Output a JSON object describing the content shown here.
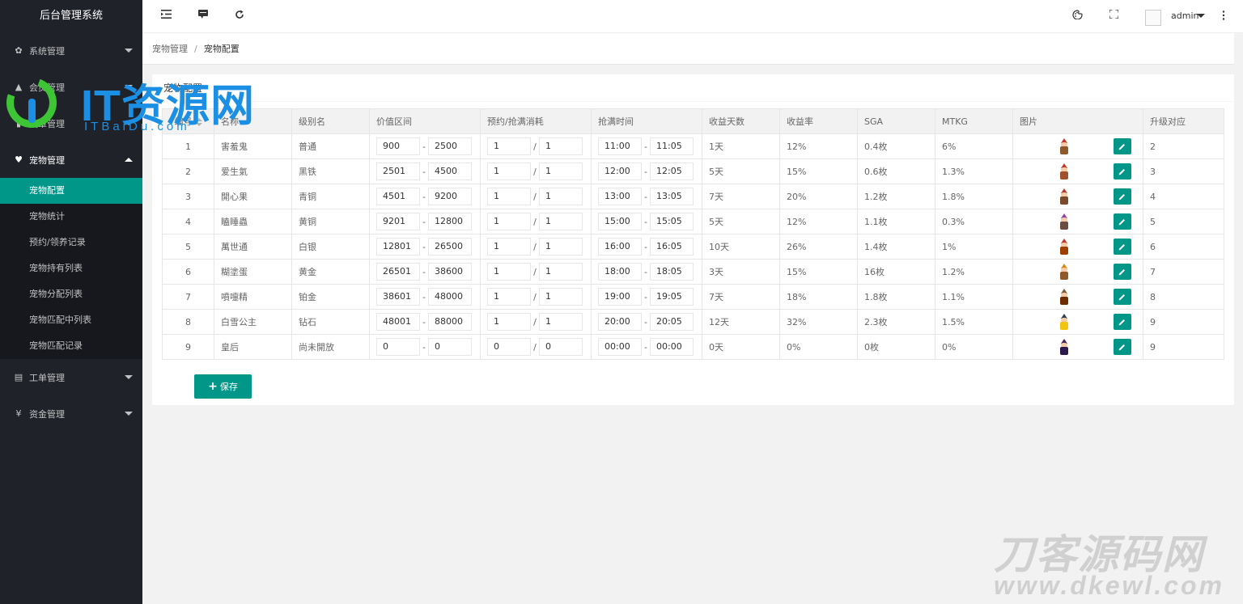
{
  "app_title": "后台管理系统",
  "sidebar": {
    "groups": [
      {
        "label": "系统管理",
        "icon": "gear-icon",
        "glyph": "✿",
        "open": false
      },
      {
        "label": "会员管理",
        "icon": "user-icon",
        "glyph": "▲",
        "open": false
      },
      {
        "label": "文章管理",
        "icon": "document-icon",
        "glyph": "▮",
        "open": false
      },
      {
        "label": "宠物管理",
        "icon": "heart-icon",
        "glyph": "♥",
        "open": true
      },
      {
        "label": "工单管理",
        "icon": "file-icon",
        "glyph": "▤",
        "open": false
      },
      {
        "label": "资金管理",
        "icon": "yen-icon",
        "glyph": "¥",
        "open": false
      }
    ],
    "pet_sub_items": [
      {
        "label": "宠物配置",
        "active": true
      },
      {
        "label": "宠物统计",
        "active": false
      },
      {
        "label": "预约/领养记录",
        "active": false
      },
      {
        "label": "宠物持有列表",
        "active": false
      },
      {
        "label": "宠物分配列表",
        "active": false
      },
      {
        "label": "宠物匹配中列表",
        "active": false
      },
      {
        "label": "宠物匹配记录",
        "active": false
      }
    ]
  },
  "header": {
    "user_name": "admin",
    "icons": [
      "menu-indent-icon",
      "message-icon",
      "refresh-icon",
      "theme-icon",
      "fullscreen-icon",
      "more-icon"
    ]
  },
  "breadcrumb": {
    "parent": "宠物管理",
    "separator": "/",
    "current": "宠物配置"
  },
  "card": {
    "title": "宠物配置"
  },
  "table": {
    "headers": [
      "编号",
      "名称",
      "级别名",
      "价值区间",
      "预约/抢满消耗",
      "抢满时间",
      "收益天数",
      "收益率",
      "SGA",
      "MTKG",
      "图片",
      "升级对应"
    ],
    "rows": [
      {
        "id": "1",
        "name": "害羞鬼",
        "level": "普通",
        "val_min": "900",
        "val_max": "2500",
        "cost_a": "1",
        "cost_b": "1",
        "t_start": "11:00",
        "t_end": "11:05",
        "days": "1天",
        "rate": "12%",
        "sga": "0.4枚",
        "mtkg": "6%",
        "upgrade": "2"
      },
      {
        "id": "2",
        "name": "爱生氣",
        "level": "黑铁",
        "val_min": "2501",
        "val_max": "4500",
        "cost_a": "1",
        "cost_b": "1",
        "t_start": "12:00",
        "t_end": "12:05",
        "days": "5天",
        "rate": "15%",
        "sga": "0.6枚",
        "mtkg": "1.3%",
        "upgrade": "3"
      },
      {
        "id": "3",
        "name": "開心果",
        "level": "青铜",
        "val_min": "4501",
        "val_max": "9200",
        "cost_a": "1",
        "cost_b": "1",
        "t_start": "13:00",
        "t_end": "13:05",
        "days": "7天",
        "rate": "20%",
        "sga": "1.2枚",
        "mtkg": "1.8%",
        "upgrade": "4"
      },
      {
        "id": "4",
        "name": "瞌睡蟲",
        "level": "黄铜",
        "val_min": "9201",
        "val_max": "12800",
        "cost_a": "1",
        "cost_b": "1",
        "t_start": "15:00",
        "t_end": "15:05",
        "days": "5天",
        "rate": "12%",
        "sga": "1.1枚",
        "mtkg": "0.3%",
        "upgrade": "5"
      },
      {
        "id": "5",
        "name": "萬世通",
        "level": "白银",
        "val_min": "12801",
        "val_max": "26500",
        "cost_a": "1",
        "cost_b": "1",
        "t_start": "16:00",
        "t_end": "16:05",
        "days": "10天",
        "rate": "26%",
        "sga": "1.4枚",
        "mtkg": "1%",
        "upgrade": "6"
      },
      {
        "id": "6",
        "name": "糊塗蛋",
        "level": "黄金",
        "val_min": "26501",
        "val_max": "38600",
        "cost_a": "1",
        "cost_b": "1",
        "t_start": "18:00",
        "t_end": "18:05",
        "days": "3天",
        "rate": "15%",
        "sga": "16枚",
        "mtkg": "1.2%",
        "upgrade": "7"
      },
      {
        "id": "7",
        "name": "噴嚏精",
        "level": "铂金",
        "val_min": "38601",
        "val_max": "48000",
        "cost_a": "1",
        "cost_b": "1",
        "t_start": "19:00",
        "t_end": "19:05",
        "days": "7天",
        "rate": "18%",
        "sga": "1.8枚",
        "mtkg": "1.1%",
        "upgrade": "8"
      },
      {
        "id": "8",
        "name": "白雪公主",
        "level": "钻石",
        "val_min": "48001",
        "val_max": "88000",
        "cost_a": "1",
        "cost_b": "1",
        "t_start": "20:00",
        "t_end": "20:05",
        "days": "12天",
        "rate": "32%",
        "sga": "2.3枚",
        "mtkg": "1.5%",
        "upgrade": "9"
      },
      {
        "id": "9",
        "name": "皇后",
        "level": "尚未開放",
        "val_min": "0",
        "val_max": "0",
        "cost_a": "0",
        "cost_b": "0",
        "t_start": "00:00",
        "t_end": "00:00",
        "days": "0天",
        "rate": "0%",
        "sga": "0枚",
        "mtkg": "0%",
        "upgrade": "9"
      }
    ],
    "pet_colors": [
      {
        "hat": "#c0392b",
        "body": "#8e5a2b"
      },
      {
        "hat": "#c0392b",
        "body": "#a0522d"
      },
      {
        "hat": "#b03a2e",
        "body": "#7b4a2a"
      },
      {
        "hat": "#8e44ad",
        "body": "#6d4c41"
      },
      {
        "hat": "#c0392b",
        "body": "#a04000"
      },
      {
        "hat": "#d68910",
        "body": "#8e5a2b"
      },
      {
        "hat": "#7d5a3a",
        "body": "#6e2c00"
      },
      {
        "hat": "#2e4053",
        "body": "#f1c40f"
      },
      {
        "hat": "#4a235a",
        "body": "#2c1a4d"
      }
    ]
  },
  "save_button": {
    "label": "保存",
    "icon": "plus-icon"
  },
  "watermarks": {
    "top_left_big": "IT资源网",
    "top_left_small": "ITBaiDu.com",
    "bottom_right_big": "刀客源码网",
    "bottom_right_small": "www.dkewl.com"
  },
  "colors": {
    "primary": "#009688",
    "sidebar_bg": "#20222a",
    "sidebar_sub_bg": "#17181d"
  }
}
